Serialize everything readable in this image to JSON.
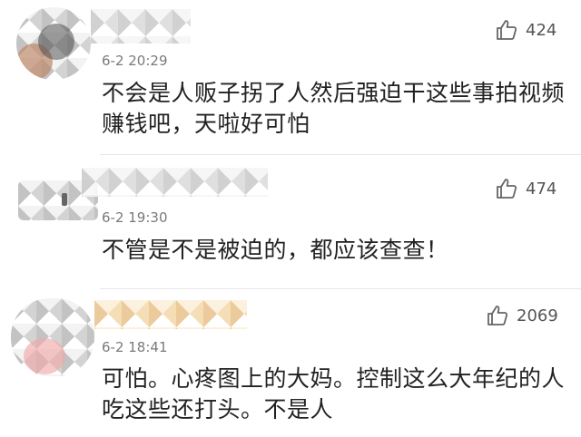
{
  "comments": [
    {
      "time": "6-2 20:29",
      "text": "不会是人贩子拐了人然后强迫干这些事拍视频赚钱吧，天啦好可怕",
      "likes": "424",
      "like_icon": "thumbs-up-icon"
    },
    {
      "time": "6-2 19:30",
      "text": "不管是不是被迫的，都应该查查！",
      "likes": "474",
      "like_icon": "thumbs-up-icon"
    },
    {
      "time": "6-2 18:41",
      "text": "可怕。心疼图上的大妈。控制这么大年纪的人吃这些还打头。不是人",
      "likes": "2069",
      "like_icon": "thumbs-up-icon"
    }
  ]
}
